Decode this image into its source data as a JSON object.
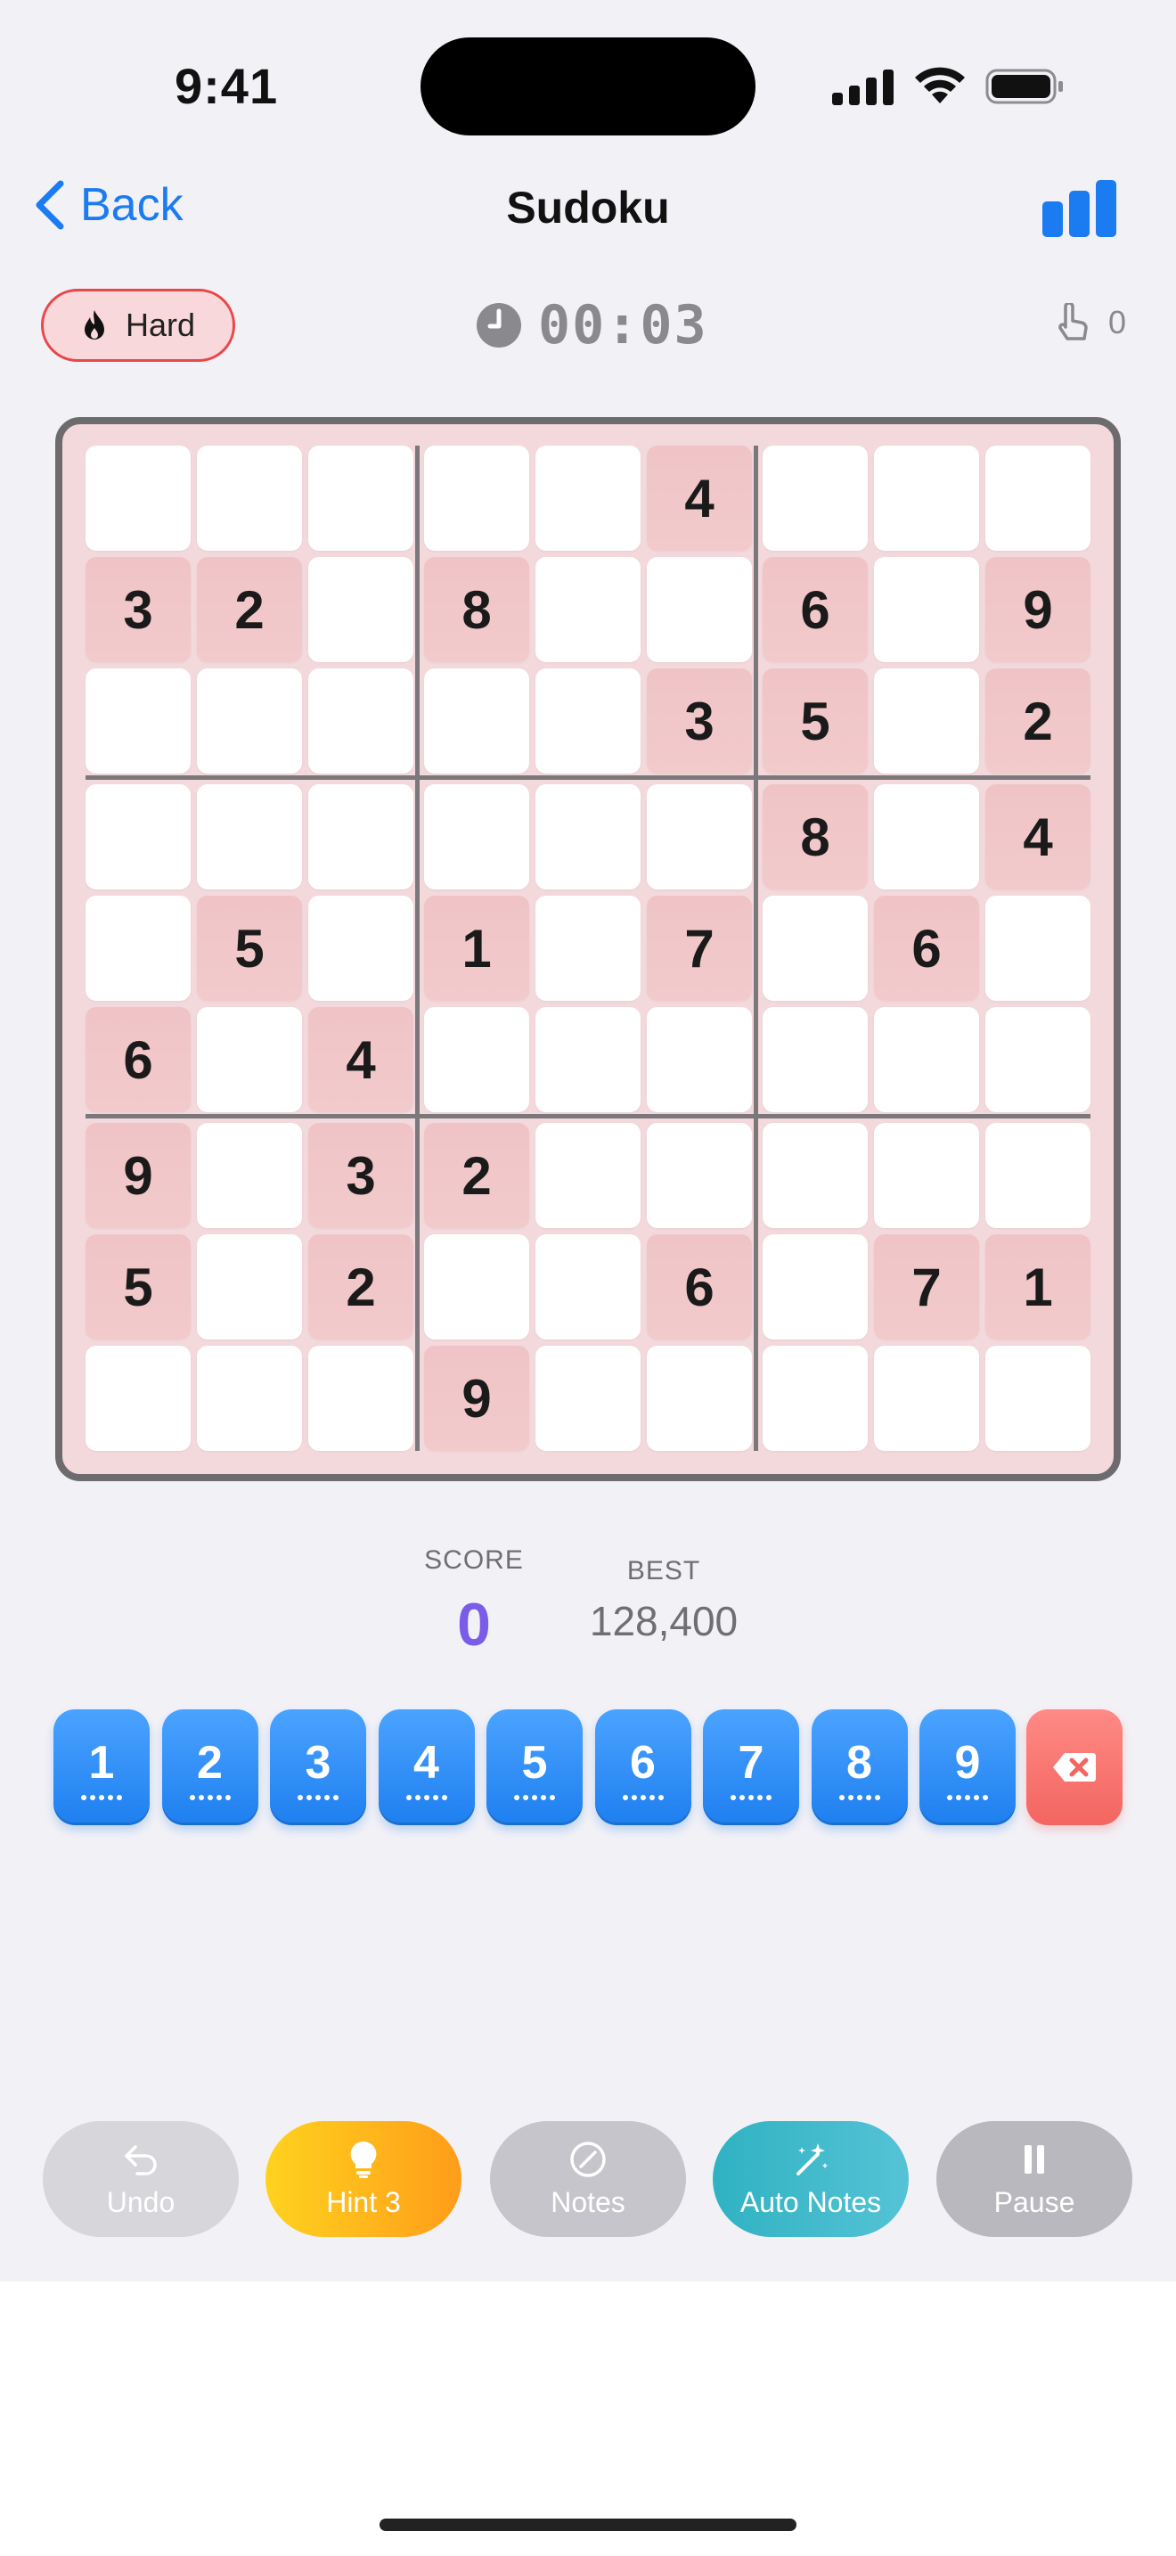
{
  "status": {
    "time": "9:41"
  },
  "nav": {
    "back_label": "Back",
    "title": "Sudoku"
  },
  "info": {
    "difficulty": "Hard",
    "timer": "00:03",
    "taps": "0"
  },
  "board": {
    "rows": [
      [
        "",
        "",
        "",
        "",
        "",
        "4",
        "",
        "",
        ""
      ],
      [
        "3",
        "2",
        "",
        "8",
        "",
        "",
        "6",
        "",
        "9"
      ],
      [
        "",
        "",
        "",
        "",
        "",
        "3",
        "5",
        "",
        "2"
      ],
      [
        "",
        "",
        "",
        "",
        "",
        "",
        "8",
        "",
        "4"
      ],
      [
        "",
        "5",
        "",
        "1",
        "",
        "7",
        "",
        "6",
        ""
      ],
      [
        "6",
        "",
        "4",
        "",
        "",
        "",
        "",
        "",
        ""
      ],
      [
        "9",
        "",
        "3",
        "2",
        "",
        "",
        "",
        "",
        ""
      ],
      [
        "5",
        "",
        "2",
        "",
        "",
        "6",
        "",
        "7",
        "1"
      ],
      [
        "",
        "",
        "",
        "9",
        "",
        "",
        "",
        "",
        ""
      ]
    ]
  },
  "score": {
    "label": "SCORE",
    "value": "0",
    "best_label": "BEST",
    "best_value": "128,400"
  },
  "numpad": {
    "keys": [
      "1",
      "2",
      "3",
      "4",
      "5",
      "6",
      "7",
      "8",
      "9"
    ]
  },
  "toolbar": {
    "undo": "Undo",
    "hint": "Hint 3",
    "notes": "Notes",
    "auto_notes": "Auto Notes",
    "pause": "Pause"
  },
  "colors": {
    "accent": "#1b7cf2",
    "difficulty": "#e8474c",
    "given_cell": "#f0c4c6",
    "hint": "#ffb81c",
    "auto_notes": "#3fb9cb",
    "score": "#7a5ce8"
  },
  "icons": {
    "back": "chevron-left-icon",
    "stats": "bar-chart-icon",
    "difficulty": "flame-icon",
    "timer": "clock-icon",
    "taps": "tap-hand-icon",
    "erase": "delete-backspace-icon",
    "undo": "undo-arrow-icon",
    "hint": "lightbulb-icon",
    "notes": "pencil-circle-icon",
    "auto_notes": "magic-wand-icon",
    "pause": "pause-icon"
  }
}
